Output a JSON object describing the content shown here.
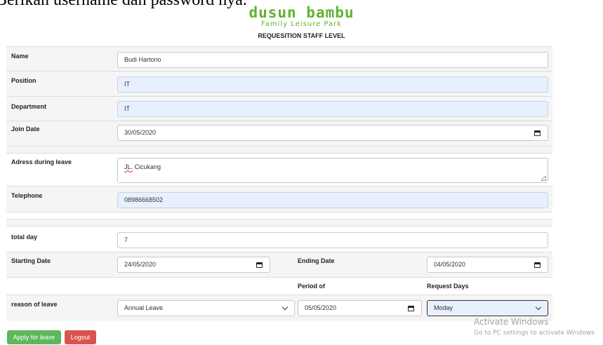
{
  "top_caption": "Berikan username dan password nya.",
  "logo": {
    "main": "dusun bambu",
    "sub": "Family Leisure Park"
  },
  "page_title": "REQUESITION STAFF LEVEL",
  "fields": {
    "name": {
      "label": "Name",
      "value": "Budi Hartono"
    },
    "position": {
      "label": "Position",
      "value": "IT"
    },
    "department": {
      "label": "Department",
      "value": "IT"
    },
    "join_date": {
      "label": "Join Date",
      "value": "30/05/2020"
    },
    "address": {
      "label": "Adress during leave",
      "value_prefix": "JL.",
      "value": " Cicukang"
    },
    "telephone": {
      "label": "Telephone",
      "value": "08986668502"
    },
    "total_day": {
      "label": "total day",
      "value": "7"
    },
    "starting_date": {
      "label": "Starting Date",
      "value": "24/05/2020"
    },
    "ending_date": {
      "label": "Ending Date",
      "value": "04/05/2020"
    },
    "period_of": {
      "label": "Period of"
    },
    "request_days": {
      "label": "Request Days"
    },
    "reason": {
      "label": "reason of leave",
      "value": "Annual Leave"
    },
    "period_date": {
      "value": "05/05/2020"
    },
    "request_day_select": {
      "value": "Moday"
    }
  },
  "buttons": {
    "apply": "Apply for leave",
    "logout": "Logout"
  },
  "watermark": {
    "title": "Activate Windows",
    "subtitle": "Go to PC settings to activate Windows"
  },
  "colors": {
    "brand_green": "#5fb32e",
    "apply_green": "#5cb85c",
    "logout_red": "#d9534f",
    "autofill_blue": "#e8f0fe"
  }
}
